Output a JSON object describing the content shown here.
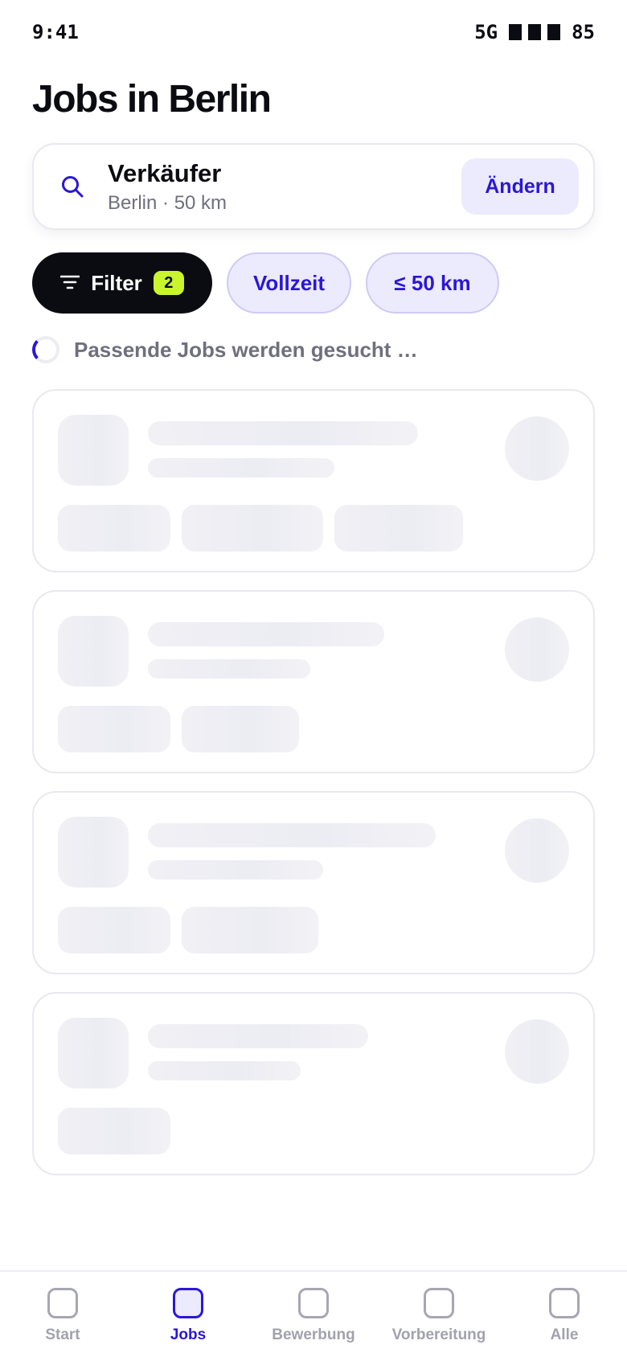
{
  "status_bar": {
    "time": "9:41",
    "network": "5G",
    "battery": "85"
  },
  "header": {
    "title": "Jobs in Berlin"
  },
  "search": {
    "query": "Verkäufer",
    "meta": "Berlin · 50 km",
    "change_label": "Ändern",
    "icon": "search-icon"
  },
  "filters": {
    "filter_label": "Filter",
    "filter_count": "2",
    "chips": [
      "Vollzeit",
      "≤ 50 km"
    ]
  },
  "loading": {
    "text": "Passende Jobs werden gesucht …"
  },
  "nav": {
    "items": [
      {
        "label": "Start",
        "active": false
      },
      {
        "label": "Jobs",
        "active": true
      },
      {
        "label": "Bewerbung",
        "active": false
      },
      {
        "label": "Vorbereitung",
        "active": false
      },
      {
        "label": "Alle",
        "active": false
      }
    ]
  },
  "colors": {
    "accent": "#2a17d6",
    "accent_soft": "#eceafd",
    "badge": "#c8f52c",
    "dark": "#0b0b12",
    "muted": "#6f6f7e"
  }
}
